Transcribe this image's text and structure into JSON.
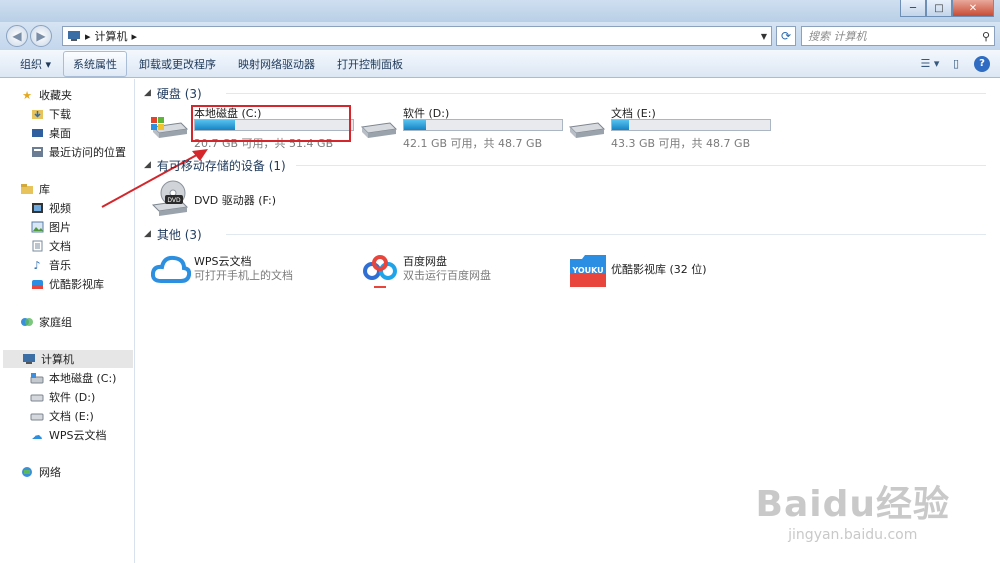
{
  "window": {
    "minimize": "─",
    "maximize": "□",
    "close": "✕"
  },
  "address": {
    "path_root": "计算机",
    "separator": "▸",
    "search_placeholder": "搜索 计算机"
  },
  "toolbar": {
    "organize": "组织 ▾",
    "system_properties": "系统属性",
    "uninstall": "卸载或更改程序",
    "map_drive": "映射网络驱动器",
    "control_panel": "打开控制面板"
  },
  "sidebar": {
    "favorites": "收藏夹",
    "downloads": "下载",
    "desktop": "桌面",
    "recent": "最近访问的位置",
    "libraries": "库",
    "videos": "视频",
    "pictures": "图片",
    "documents": "文档",
    "music": "音乐",
    "youku_lib": "优酷影视库",
    "homegroup": "家庭组",
    "computer": "计算机",
    "drive_c": "本地磁盘 (C:)",
    "drive_d": "软件 (D:)",
    "drive_e": "文档 (E:)",
    "wps_cloud": "WPS云文档",
    "network": "网络"
  },
  "groups": {
    "hard_disks": "硬盘 (3)",
    "removable": "有可移动存储的设备 (1)",
    "other": "其他 (3)"
  },
  "drives": [
    {
      "name": "本地磁盘 (C:)",
      "info": "20.7 GB 可用，共 51.4 GB",
      "used_fraction": 0.25
    },
    {
      "name": "软件 (D:)",
      "info": "42.1 GB 可用，共 48.7 GB",
      "used_fraction": 0.14
    },
    {
      "name": "文档 (E:)",
      "info": "43.3 GB 可用，共 48.7 GB",
      "used_fraction": 0.11
    }
  ],
  "dvd": {
    "name": "DVD 驱动器 (F:)",
    "label": "DVD"
  },
  "others": [
    {
      "name": "WPS云文档",
      "sub": "可打开手机上的文档"
    },
    {
      "name": "百度网盘",
      "sub": "双击运行百度网盘"
    },
    {
      "name": "优酷影视库 (32 位)",
      "sub": ""
    }
  ],
  "youku_logo": "YOUKU",
  "watermark": {
    "line1": "Baidu经验",
    "line2": "jingyan.baidu.com"
  },
  "colors": {
    "accent": "#2c6bb0",
    "highlight_box": "#d4262b",
    "drive_fill": "#1783c2"
  }
}
